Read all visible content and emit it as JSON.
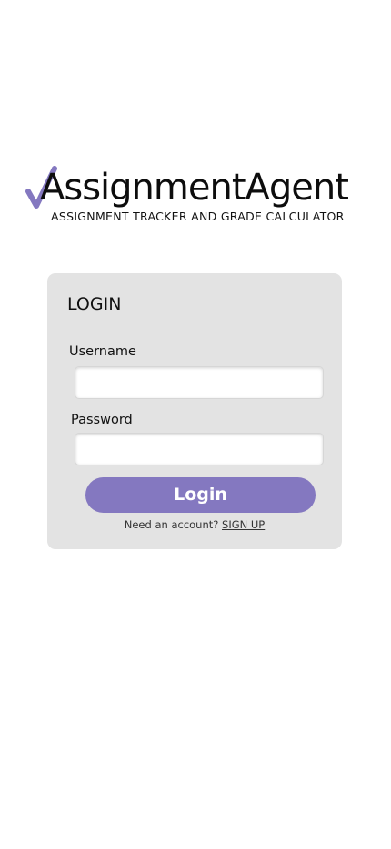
{
  "brand": {
    "logo_name": "AssignmentAgent",
    "tagline": "ASSIGNMENT TRACKER AND GRADE CALCULATOR",
    "check_icon": "checkmark-icon",
    "accent_color": "#8478c0"
  },
  "login": {
    "title": "LOGIN",
    "username_label": "Username",
    "username_value": "",
    "password_label": "Password",
    "password_value": "",
    "button_label": "Login",
    "signup_prompt": "Need an account?",
    "signup_link": "SIGN UP"
  }
}
